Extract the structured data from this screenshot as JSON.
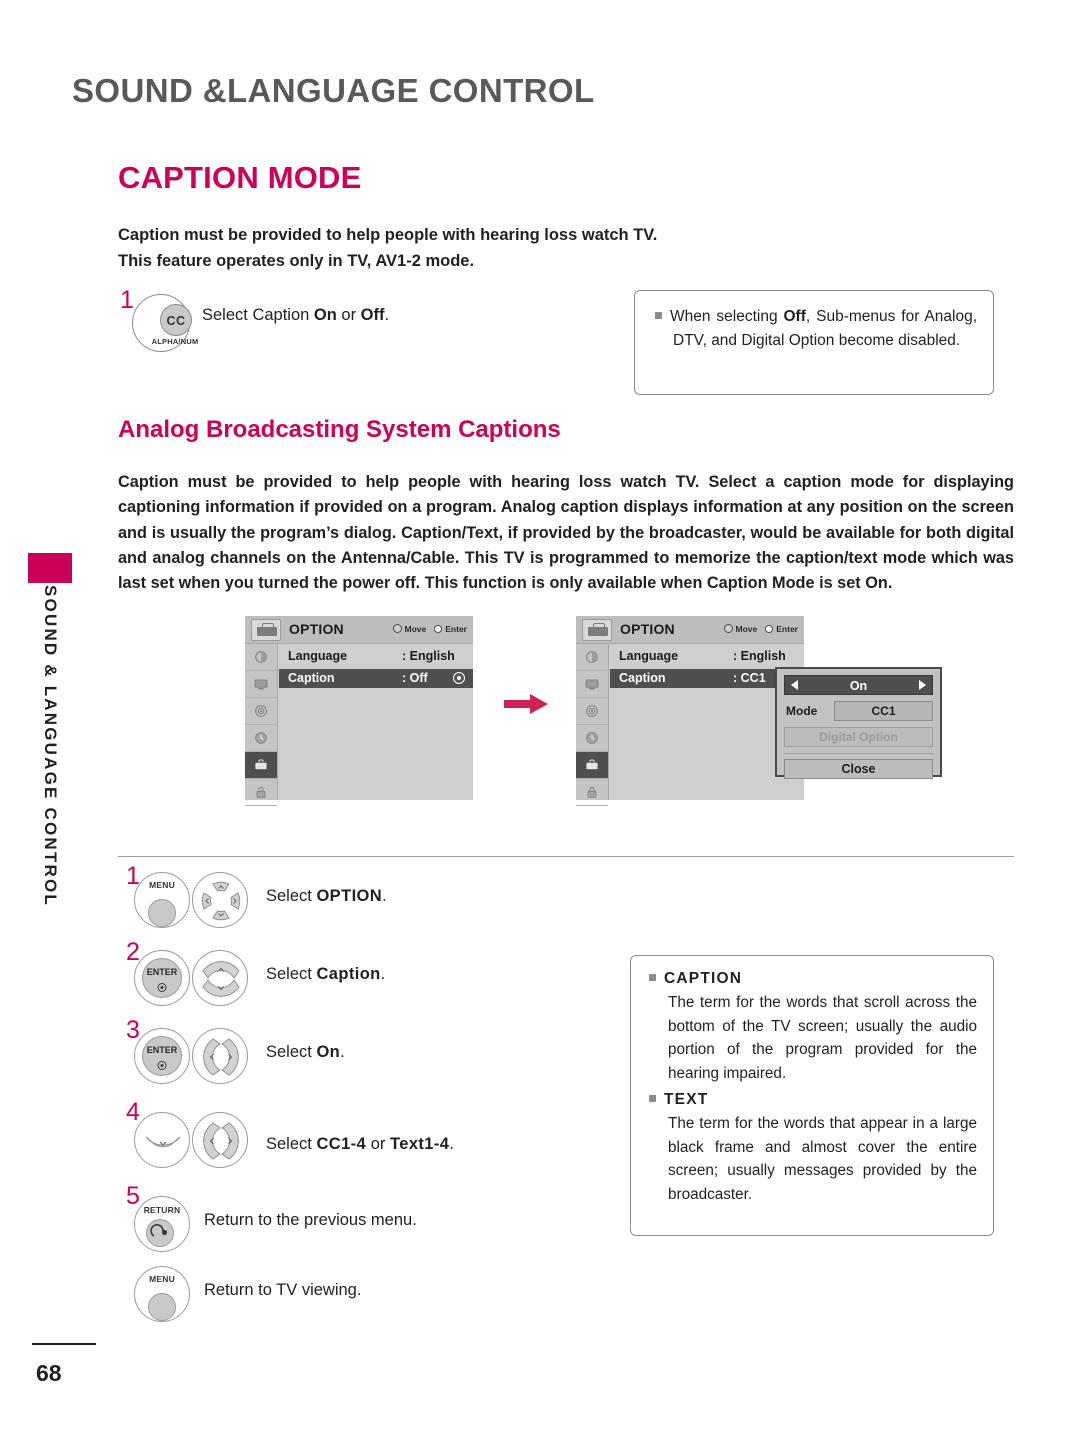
{
  "chapter": {
    "title": "SOUND &LANGUAGE CONTROL",
    "side_tab_text": "SOUND & LANGUAGE CONTROL"
  },
  "section": {
    "title": "CAPTION MODE"
  },
  "intro": {
    "line1": "Caption must be provided to help people with hearing loss watch TV.",
    "line2": "This feature operates only in TV, AV1-2 mode."
  },
  "cc_step": {
    "number": "1",
    "button_label": "CC",
    "button_sublabel": "ALPHA/NUM",
    "text_prefix": "Select Caption ",
    "text_on": "On",
    "text_mid": " or ",
    "text_off": "Off",
    "text_suffix": "."
  },
  "note_top": {
    "text_a": "When selecting ",
    "text_bold": "Off",
    "text_b": ", Sub-menus for Analog, DTV, and Digital Option become disabled."
  },
  "sub_heading": "Analog Broadcasting System Captions",
  "body_paragraph": {
    "part1": "Caption must be provided to help people with hearing loss watch TV. Select a caption mode for displaying captioning information if provided on a program. Analog caption displays information at any position on the screen and is usually the program’s dialog. Caption/Text, if provided by the broadcaster, would be available for both digital and analog channels on the Antenna/Cable. This TV is programmed to memorize the caption/text mode which was last set when you turned the power off. This function is only available when ",
    "bold1": "Caption",
    "part2": " Mode is set ",
    "bold2": "On",
    "part3": "."
  },
  "osd_menu_1": {
    "title": "OPTION",
    "hint_move": "Move",
    "hint_enter": "Enter",
    "rows": [
      {
        "label": "Language",
        "value": ": English",
        "selected": false
      },
      {
        "label": "Caption",
        "value": ": Off",
        "selected": true
      }
    ],
    "sidebar_icons": [
      "picture-icon",
      "screen-icon",
      "audio-icon",
      "time-icon",
      "option-icon",
      "lock-icon"
    ]
  },
  "osd_menu_2": {
    "title": "OPTION",
    "hint_move": "Move",
    "hint_enter": "Enter",
    "rows": [
      {
        "label": "Language",
        "value": ": English",
        "selected": false
      },
      {
        "label": "Caption",
        "value": ": CC1",
        "selected": true
      }
    ],
    "sidebar_icons": [
      "picture-icon",
      "screen-icon",
      "audio-icon",
      "time-icon",
      "option-icon",
      "lock-icon"
    ]
  },
  "osd_dialog": {
    "onoff_value": "On",
    "mode_label": "Mode",
    "mode_value": "CC1",
    "digital_option": "Digital Option",
    "close": "Close"
  },
  "remote_steps": [
    {
      "number": "1",
      "text_prefix": "Select ",
      "text_bold": "OPTION",
      "text_suffix": ".",
      "buttons": [
        "menu-button",
        "navigation-pad"
      ]
    },
    {
      "number": "2",
      "text_prefix": "Select ",
      "text_bold": "Caption",
      "text_suffix": ".",
      "buttons": [
        "enter-button",
        "up-down-button"
      ]
    },
    {
      "number": "3",
      "text_prefix": "Select ",
      "text_bold": "On",
      "text_suffix": ".",
      "buttons": [
        "enter-button",
        "left-right-button"
      ]
    },
    {
      "number": "4",
      "text_prefix": "Select ",
      "text_bold": "CC1-4",
      "text_mid": " or ",
      "text_bold2": "Text1-4",
      "text_suffix": ".",
      "buttons": [
        "down-button",
        "left-right-button"
      ]
    },
    {
      "number": "5",
      "text_prefix": "Return to the previous menu.",
      "buttons": [
        "return-button"
      ]
    }
  ],
  "button_labels": {
    "menu": "MENU",
    "enter": "ENTER",
    "return": "RETURN"
  },
  "final_step": {
    "text": "Return to TV viewing."
  },
  "note_bottom": {
    "caption_head": "CAPTION",
    "caption_body": "The term for the words that scroll across the bottom of the TV screen; usually the audio portion of the program provided for the hearing impaired.",
    "text_head": "TEXT",
    "text_body": "The term for the words that appear in a large black frame and almost cover the entire screen; usually messages provided by the broadcaster."
  },
  "page_number": "68",
  "colors": {
    "accent": "#cc0055",
    "chapter_gray": "#595959",
    "osd_bg": "#cfcfcf",
    "osd_select": "#4f4f4f"
  }
}
